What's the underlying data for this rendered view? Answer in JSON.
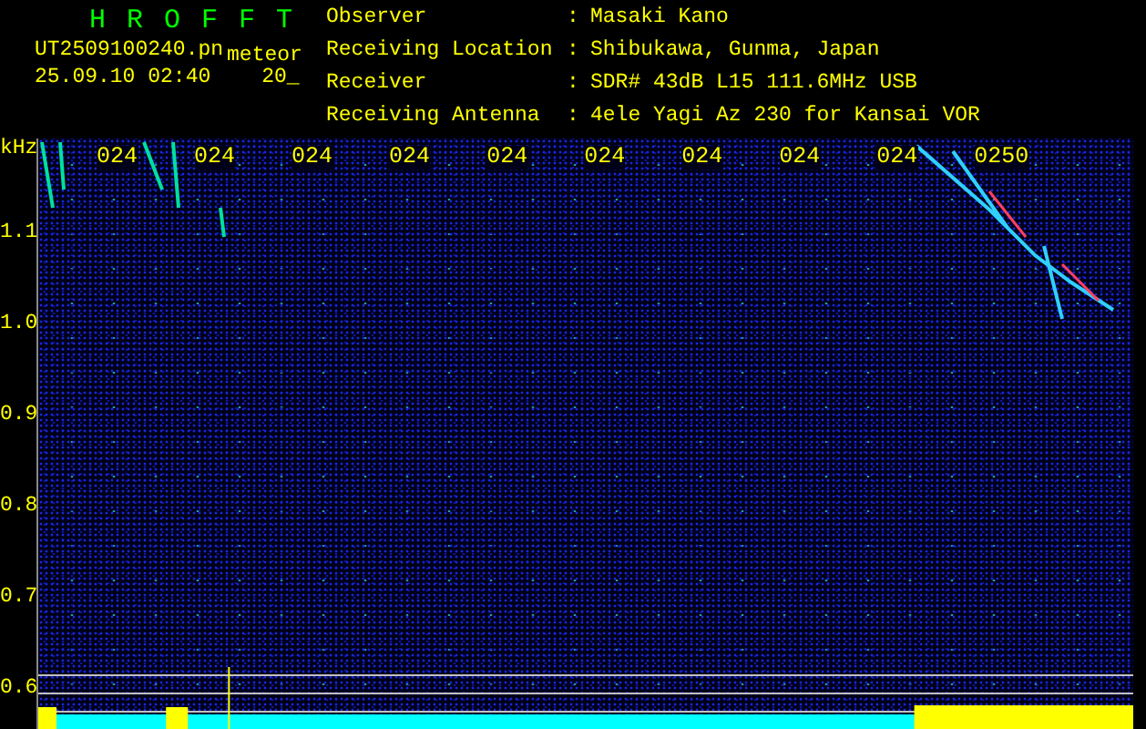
{
  "header": {
    "title": "HROFFT",
    "file_name": "UT2509100240.pn",
    "mode": "meteor",
    "date_time": "25.09.10 02:40",
    "setting": "20_",
    "fields": [
      {
        "label": "Observer",
        "colon": ":",
        "value": "Masaki Kano"
      },
      {
        "label": "Receiving Location",
        "colon": ":",
        "value": "Shibukawa, Gunma, Japan"
      },
      {
        "label": "Receiver",
        "colon": ":",
        "value": "SDR# 43dB L15 111.6MHz USB"
      },
      {
        "label": "Receiving Antenna",
        "colon": ":",
        "value": "4ele Yagi Az 230 for Kansai VOR"
      }
    ]
  },
  "plot": {
    "y_unit": "kHz",
    "y_labels": [
      "1.1",
      "1.0",
      "0.9",
      "0.8",
      "0.7",
      "0.6"
    ],
    "time_labels": [
      "024",
      "024",
      "024",
      "024",
      "024",
      "024",
      "024",
      "024",
      "024",
      "0250"
    ]
  }
}
